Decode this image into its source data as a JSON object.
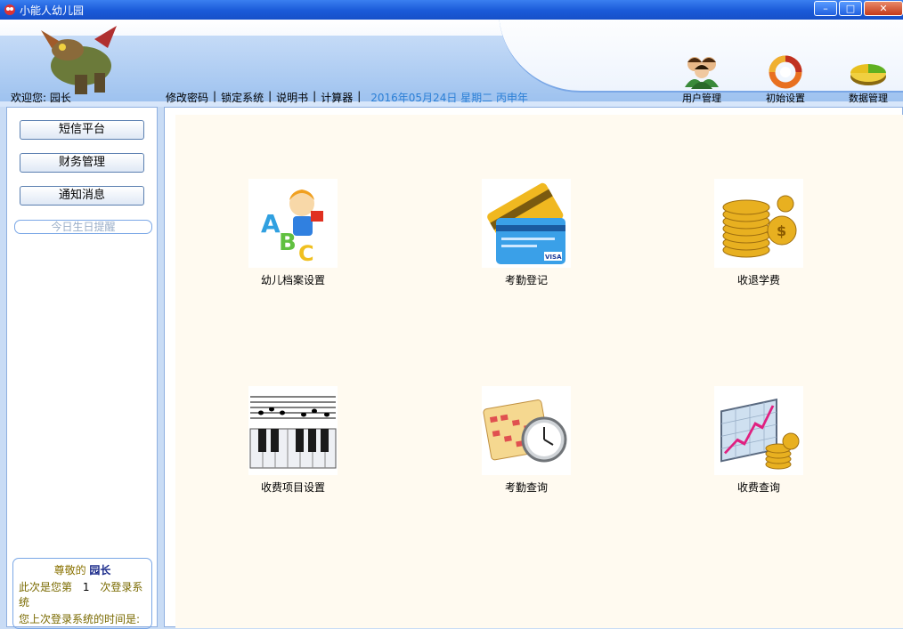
{
  "window": {
    "title": "小能人幼儿园",
    "min": "–",
    "max": "□",
    "close": "✕"
  },
  "header": {
    "welcome": "欢迎您: 园长",
    "links": [
      "修改密码",
      "锁定系统",
      "说明书",
      "计算器"
    ],
    "separator": "|",
    "date": "2016年05月24日  星期二  丙申年",
    "icons": [
      {
        "label": "用户管理",
        "icon": "users-icon"
      },
      {
        "label": "初始设置",
        "icon": "settings-ring-icon"
      },
      {
        "label": "数据管理",
        "icon": "data-pie-icon"
      }
    ]
  },
  "sidebar": {
    "buttons": [
      "短信平台",
      "财务管理",
      "通知消息"
    ],
    "birthday": "今日生日提醒",
    "login": {
      "greet_prefix": "尊敬的",
      "greet_name": "园长",
      "line1_prefix": "此次是您第",
      "count": "1",
      "line1_suffix": "次登录系统",
      "line2": "您上次登录系统的时间是:"
    }
  },
  "tiles": [
    {
      "label": "幼儿档案设置",
      "icon": "abc-child-icon"
    },
    {
      "label": "考勤登记",
      "icon": "credit-card-icon"
    },
    {
      "label": "收退学费",
      "icon": "coins-icon"
    },
    {
      "label": "收费项目设置",
      "icon": "piano-icon"
    },
    {
      "label": "考勤查询",
      "icon": "calendar-clock-icon"
    },
    {
      "label": "收费查询",
      "icon": "chart-coins-icon"
    }
  ]
}
